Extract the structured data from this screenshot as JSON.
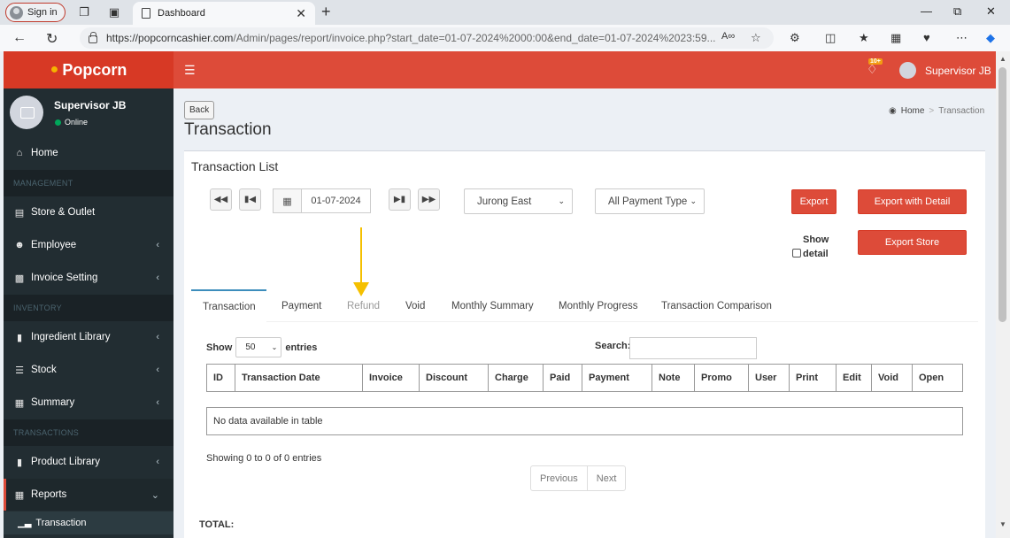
{
  "browser": {
    "signin_label": "Sign in",
    "tab_title": "Dashboard",
    "url_host": "https://popcorncashier.com",
    "url_path": "/Admin/pages/report/invoice.php?start_date=01-07-2024%2000:00&end_date=01-07-2024%2023:59..."
  },
  "app": {
    "brand": "Popcorn",
    "notification_count": "10+",
    "header_user": "Supervisor JB"
  },
  "sidebar": {
    "user_name": "Supervisor JB",
    "user_status": "Online",
    "home": "Home",
    "section_management": "MANAGEMENT",
    "store_outlet": "Store & Outlet",
    "employee": "Employee",
    "invoice_setting": "Invoice Setting",
    "section_inventory": "INVENTORY",
    "ingredient_library": "Ingredient Library",
    "stock": "Stock",
    "summary": "Summary",
    "section_transactions": "TRANSACTIONS",
    "product_library": "Product Library",
    "reports": "Reports",
    "transaction": "Transaction"
  },
  "page": {
    "back_label": "Back",
    "title": "Transaction",
    "breadcrumb_home": "Home",
    "breadcrumb_sep": ">",
    "breadcrumb_current": "Transaction"
  },
  "box": {
    "title": "Transaction List",
    "date_value": "01-07-2024",
    "outlet_selected": "Jurong East",
    "payment_type_selected": "All Payment Type",
    "export_label": "Export",
    "export_detail_label": "Export with Detail",
    "show_detail_label": "Show detail",
    "export_store_label": "Export Store"
  },
  "tabs": [
    "Transaction",
    "Payment",
    "Refund",
    "Void",
    "Monthly Summary",
    "Monthly Progress",
    "Transaction Comparison"
  ],
  "table": {
    "show_label": "Show",
    "entries_value": "50",
    "entries_label": "entries",
    "search_label": "Search:",
    "columns": [
      "ID",
      "Transaction Date",
      "Invoice",
      "Discount",
      "Charge",
      "Paid",
      "Payment",
      "Note",
      "Promo",
      "User",
      "Print",
      "Edit",
      "Void",
      "Open"
    ],
    "empty_message": "No data available in table",
    "info": "Showing 0 to 0 of 0 entries",
    "previous_label": "Previous",
    "next_label": "Next",
    "total_label": "TOTAL:"
  },
  "colors": {
    "header_red": "#dd4b39",
    "logo_red": "#d73925",
    "sidebar_dark": "#222d32",
    "tab_active_border": "#3c8dbc",
    "annotation_arrow": "#f5c000",
    "online_green": "#00a65a"
  }
}
